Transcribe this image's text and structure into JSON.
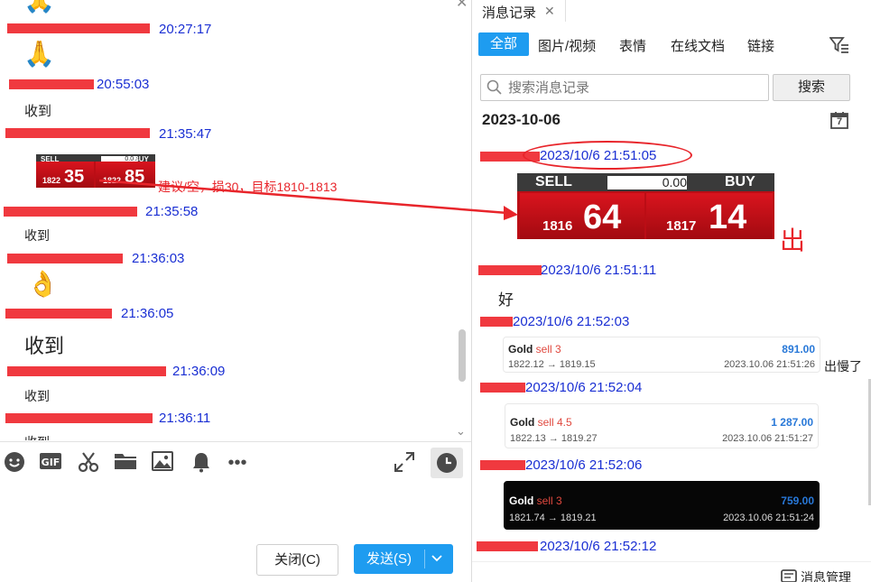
{
  "chat": {
    "messages": [
      {
        "time": "20:27:17"
      },
      {
        "time": "20:55:03",
        "text": "收到"
      },
      {
        "time": "21:35:47",
        "annotation": "建议/空，损30，目标1810-1813"
      },
      {
        "time": "21:35:58",
        "text": "收到"
      },
      {
        "time": "21:36:03"
      },
      {
        "time": "21:36:05",
        "text": "收到"
      },
      {
        "time": "21:36:09",
        "text": "收到"
      },
      {
        "time": "21:36:11",
        "text": "收到"
      }
    ],
    "small_ticket": {
      "sell": "SELL",
      "buy": "BUY",
      "qty": "0.00",
      "bid_small": "1822",
      "bid_big": "35",
      "ask_small": "1822",
      "ask_big": "85"
    },
    "emoji_pray": "🙏",
    "emoji_ok": "👌"
  },
  "toolbar": {
    "close_label": "关闭(C)",
    "send_label": "发送(S)"
  },
  "history": {
    "tab_title": "消息记录",
    "filters": [
      "全部",
      "图片/视频",
      "表情",
      "在线文档",
      "链接"
    ],
    "search_placeholder": "搜索消息记录",
    "search_button": "搜索",
    "date": "2023-10-06",
    "calendar_day": "7",
    "entries": [
      {
        "time": "2023/10/6 21:51:05"
      },
      {
        "time": "2023/10/6 21:51:11",
        "text": "好"
      },
      {
        "time": "2023/10/6 21:52:03"
      },
      {
        "time": "2023/10/6 21:52:04"
      },
      {
        "time": "2023/10/6 21:52:06"
      },
      {
        "time": "2023/10/6 21:52:12"
      }
    ],
    "big_ticket": {
      "sell": "SELL",
      "buy": "BUY",
      "qty": "0.00",
      "bid_small": "1816",
      "bid_big": "64",
      "ask_small": "1817",
      "ask_big": "14"
    },
    "out_label": "出",
    "slow_label": "出慢了",
    "cards": [
      {
        "gold": "Gold",
        "side": "sell 3",
        "amount": "891.00",
        "range": "1822.12 → 1819.15",
        "stamp": "2023.10.06 21:51:26"
      },
      {
        "gold": "Gold",
        "side": "sell 4.5",
        "amount": "1 287.00",
        "range": "1822.13 → 1819.27",
        "stamp": "2023.10.06 21:51:27"
      },
      {
        "gold": "Gold",
        "side": "sell 3",
        "amount": "759.00",
        "range": "1821.74 → 1819.21",
        "stamp": "2023.10.06 21:51:24"
      }
    ],
    "manage_label": "消息管理"
  },
  "colors": {
    "accent": "#1e9cf0",
    "timestamp": "#1a2fd3",
    "redaction": "#f0393f",
    "annotation": "#e8252b"
  }
}
